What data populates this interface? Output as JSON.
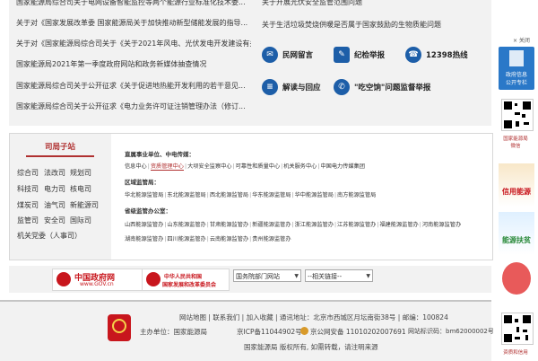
{
  "news": {
    "items": [
      "国家能源局综合司关于电网设备智能监控等两个能源行业标准化技术委...",
      "关于对《国家发展改革委 国家能源局关于加快推动新型储能发展的指导...",
      "关于对《国家能源局综合司关于《关于2021年风电、光伏发电开发建设有关事...",
      "国家能源局2021年第一季度政府网站和政务新媒体抽查情况",
      "国家能源局综合司关于公开征求《关于促进地热能开发利用的若干意见...",
      "国家能源局综合司关于公开征求《电力业务许可证注销管理办法（修订..."
    ],
    "right_items": [
      "关于开展光伏安全监管范围问题",
      "关于生活垃圾焚烧供暖是否属于国家鼓励的生物质能问题"
    ],
    "services": {
      "mailbox": "民网留言",
      "report": "纪检举报",
      "hotline": "12398热线",
      "interpret": "解读与回应",
      "complaint": "\"吃空饷\"问题监督举报"
    }
  },
  "bureau": {
    "heading": "司局子站",
    "links": [
      "综合司",
      "法改司",
      "规划司",
      "科技司",
      "电力司",
      "核电司",
      "煤炭司",
      "油气司",
      "新能源司",
      "监管司",
      "安全司",
      "国际司",
      "机关党委（人事司）"
    ],
    "direct_title": "直属事业单位、中电传媒：",
    "direct_links": [
      "信息中心",
      "资质管理中心",
      "大坝安全监察中心",
      "可靠性和质量中心",
      "机关服务中心",
      "中国电力传媒集团"
    ],
    "regional_title": "区域监管局：",
    "regional_links": [
      "华北能源监管局",
      "东北能源监管局",
      "西北能源监管局",
      "华东能源监管局",
      "华中能源监管局",
      "南方能源监管局"
    ],
    "office_title": "省级监管办公室：",
    "office_links_1": [
      "山西能源监管办",
      "山东能源监管办",
      "甘肃能源监管办",
      "新疆能源监管办",
      "浙江能源监管办",
      "江苏能源监管办",
      "福建能源监管办",
      "河南能源监管办"
    ],
    "office_links_2": [
      "湖南能源监管办",
      "四川能源监管办",
      "云南能源监管办",
      "贵州能源监管办"
    ]
  },
  "banners": {
    "gov_site_cn": "中国政府网",
    "gov_site_url": "www.GOV.cn",
    "ndrc_cn": "中华人民共和国",
    "ndrc_cn2": "国家发展和改革委员会",
    "select1": "国务院部门网站",
    "select2": "--相关链接--"
  },
  "footer": {
    "line1": "网站地图 | 联系我们 | 加入收藏 | 通讯地址：北京市西城区月坛南街38号 | 邮编：100824",
    "host_label": "主办单位：",
    "host": "国家能源局",
    "icp": "京ICP备11044902号",
    "police": "京公网安备 11010202007691",
    "site_code": "网站标识码：bm62000002号",
    "copyright": "国家能源局 版权所有, 如需转载，请注明来源"
  },
  "sidebar": {
    "close": "× 关闭",
    "public_label_1": "政府信息",
    "public_label_2": "公开专栏",
    "wechat_caption_1": "国家能源局",
    "wechat_caption_2": "微信",
    "credit": "信用能源",
    "poverty": "能源扶贫",
    "app_caption": "资质和信用"
  }
}
